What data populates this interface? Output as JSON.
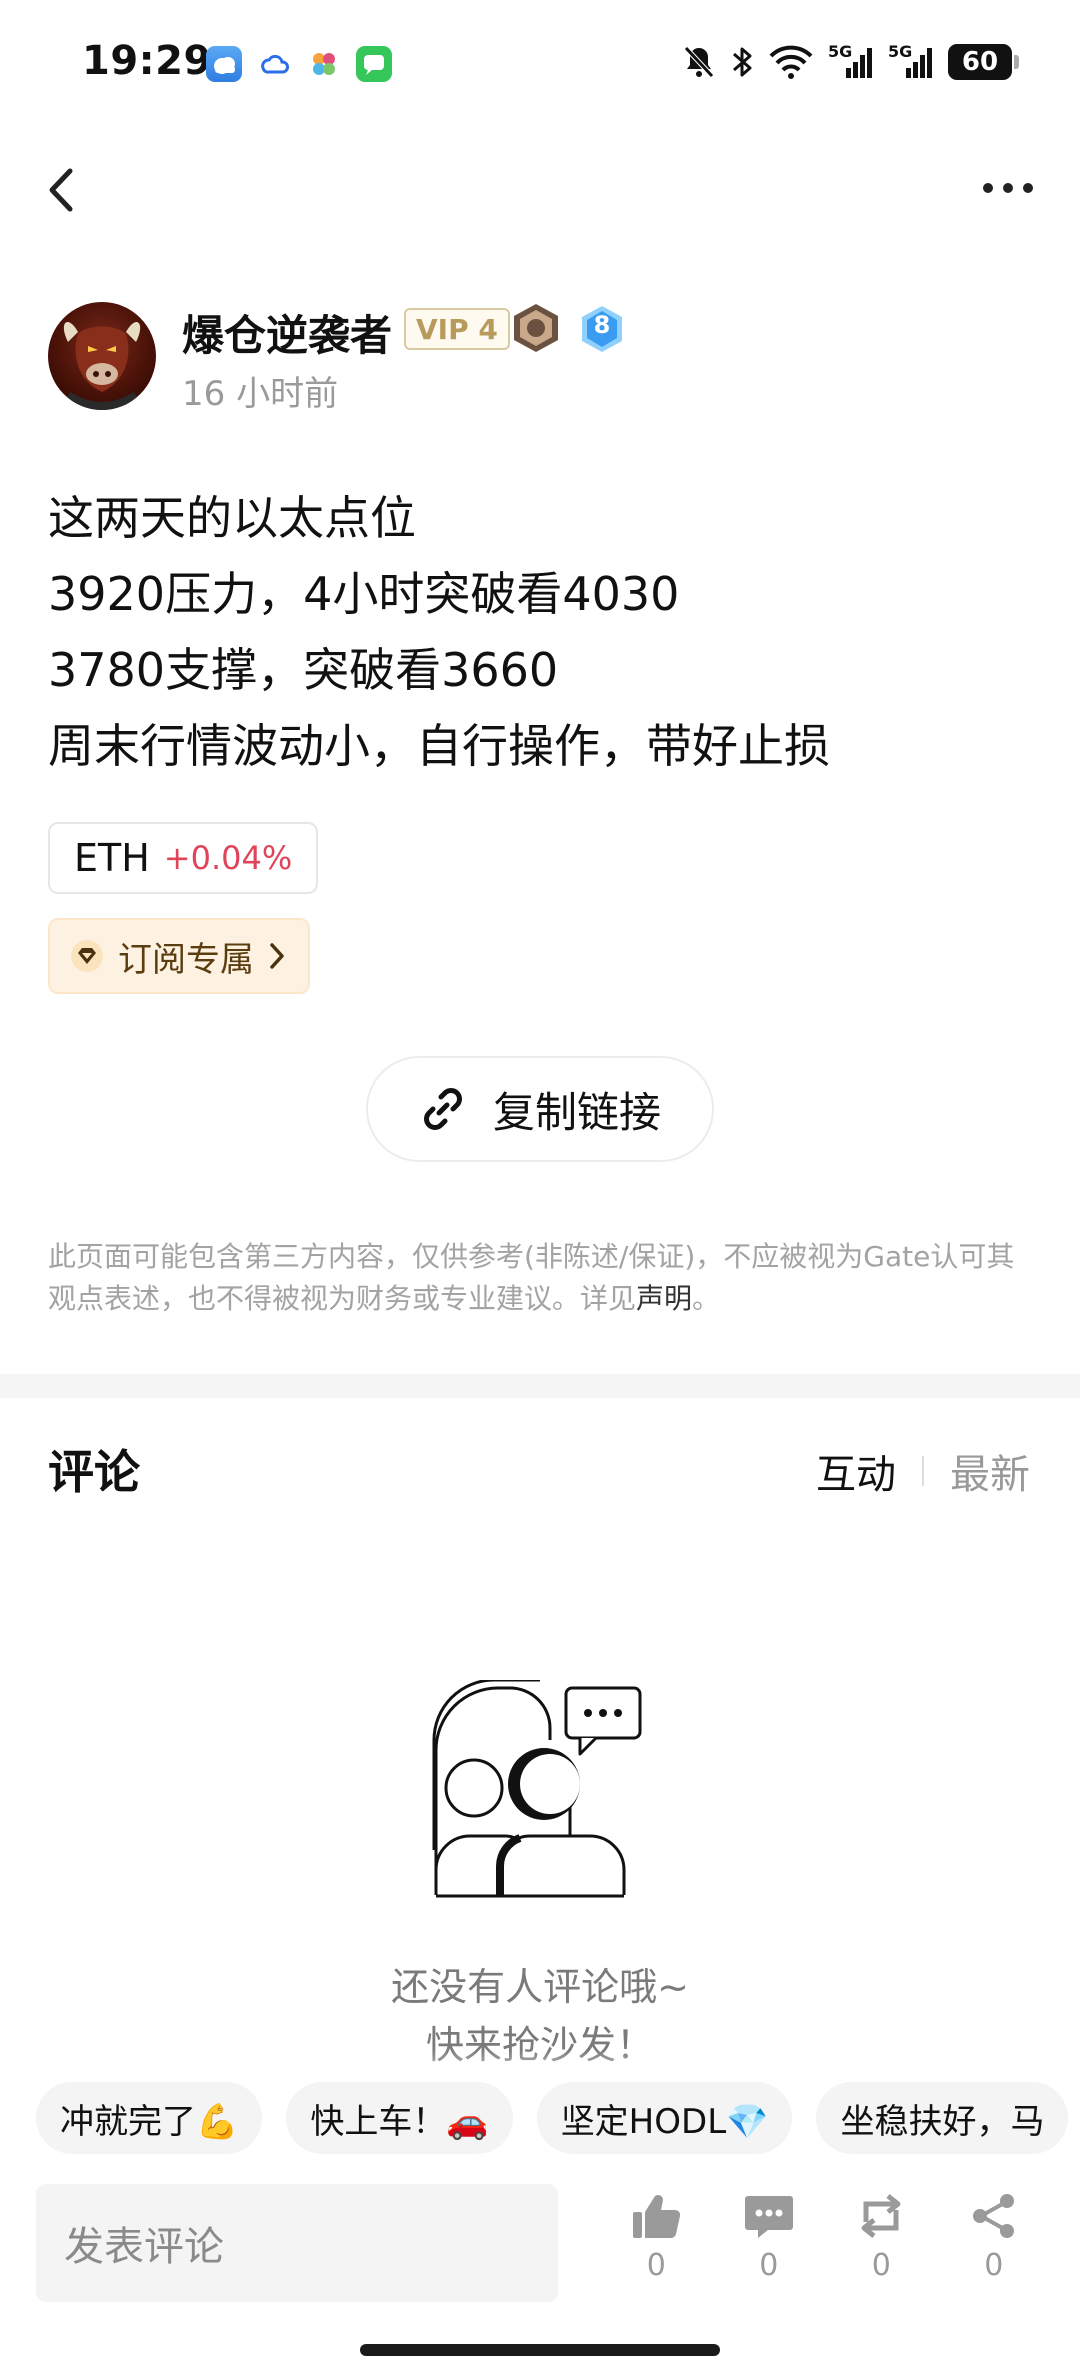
{
  "status_bar": {
    "time": "19:29",
    "battery": "60",
    "icons": [
      "weather-app-icon",
      "cloud-app-icon",
      "photos-app-icon",
      "messages-app-icon",
      "mute-icon",
      "bluetooth-icon",
      "wifi-icon",
      "signal-5g-icon",
      "signal-5g-icon"
    ],
    "net_label_1": "5G",
    "net_label_2": "5G"
  },
  "nav": {
    "back_icon": "chevron-left-icon",
    "more_icon": "more-dots-icon"
  },
  "author": {
    "name": "爆仓逆袭者",
    "vip": "VIP 4",
    "level": "8",
    "time_ago": "16 小时前"
  },
  "post": {
    "lines": [
      "这两天的以太点位",
      "3920压力，4小时突破看4030",
      "3780支撑，突破看3660",
      "周末行情波动小，自行操作，带好止损"
    ]
  },
  "coin_tag": {
    "symbol": "ETH",
    "change": "+0.04%",
    "change_color": "#e0445a"
  },
  "subscription": {
    "label": "订阅专属"
  },
  "copy_link": {
    "label": "复制链接"
  },
  "disclaimer": {
    "text": "此页面可能包含第三方内容，仅供参考(非陈述/保证)，不应被视为Gate认可其观点表述，也不得被视为财务或专业建议。详见",
    "link": "声明",
    "end": "。"
  },
  "comments": {
    "title": "评论",
    "tabs": [
      "互动",
      "最新"
    ],
    "active_tab": "互动",
    "empty_line1": "还没有人评论哦~",
    "empty_line2": "快来抢沙发！"
  },
  "quick_replies": [
    "冲就完了💪",
    "快上车！🚗",
    "坚定HODL💎",
    "坐稳扶好，马"
  ],
  "bottom_bar": {
    "input_placeholder": "发表评论",
    "like_count": "0",
    "comment_count": "0",
    "repost_count": "0",
    "share_count": "0"
  }
}
